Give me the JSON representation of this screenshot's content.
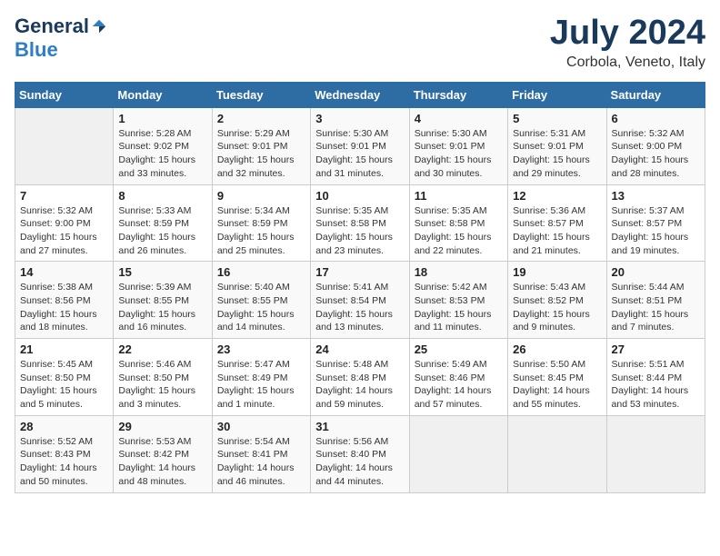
{
  "header": {
    "logo_general": "General",
    "logo_blue": "Blue",
    "month_title": "July 2024",
    "location": "Corbola, Veneto, Italy"
  },
  "days_of_week": [
    "Sunday",
    "Monday",
    "Tuesday",
    "Wednesday",
    "Thursday",
    "Friday",
    "Saturday"
  ],
  "weeks": [
    [
      {
        "day": "",
        "empty": true
      },
      {
        "day": "1",
        "sunrise": "Sunrise: 5:28 AM",
        "sunset": "Sunset: 9:02 PM",
        "daylight": "Daylight: 15 hours and 33 minutes."
      },
      {
        "day": "2",
        "sunrise": "Sunrise: 5:29 AM",
        "sunset": "Sunset: 9:01 PM",
        "daylight": "Daylight: 15 hours and 32 minutes."
      },
      {
        "day": "3",
        "sunrise": "Sunrise: 5:30 AM",
        "sunset": "Sunset: 9:01 PM",
        "daylight": "Daylight: 15 hours and 31 minutes."
      },
      {
        "day": "4",
        "sunrise": "Sunrise: 5:30 AM",
        "sunset": "Sunset: 9:01 PM",
        "daylight": "Daylight: 15 hours and 30 minutes."
      },
      {
        "day": "5",
        "sunrise": "Sunrise: 5:31 AM",
        "sunset": "Sunset: 9:01 PM",
        "daylight": "Daylight: 15 hours and 29 minutes."
      },
      {
        "day": "6",
        "sunrise": "Sunrise: 5:32 AM",
        "sunset": "Sunset: 9:00 PM",
        "daylight": "Daylight: 15 hours and 28 minutes."
      }
    ],
    [
      {
        "day": "7",
        "sunrise": "Sunrise: 5:32 AM",
        "sunset": "Sunset: 9:00 PM",
        "daylight": "Daylight: 15 hours and 27 minutes."
      },
      {
        "day": "8",
        "sunrise": "Sunrise: 5:33 AM",
        "sunset": "Sunset: 8:59 PM",
        "daylight": "Daylight: 15 hours and 26 minutes."
      },
      {
        "day": "9",
        "sunrise": "Sunrise: 5:34 AM",
        "sunset": "Sunset: 8:59 PM",
        "daylight": "Daylight: 15 hours and 25 minutes."
      },
      {
        "day": "10",
        "sunrise": "Sunrise: 5:35 AM",
        "sunset": "Sunset: 8:58 PM",
        "daylight": "Daylight: 15 hours and 23 minutes."
      },
      {
        "day": "11",
        "sunrise": "Sunrise: 5:35 AM",
        "sunset": "Sunset: 8:58 PM",
        "daylight": "Daylight: 15 hours and 22 minutes."
      },
      {
        "day": "12",
        "sunrise": "Sunrise: 5:36 AM",
        "sunset": "Sunset: 8:57 PM",
        "daylight": "Daylight: 15 hours and 21 minutes."
      },
      {
        "day": "13",
        "sunrise": "Sunrise: 5:37 AM",
        "sunset": "Sunset: 8:57 PM",
        "daylight": "Daylight: 15 hours and 19 minutes."
      }
    ],
    [
      {
        "day": "14",
        "sunrise": "Sunrise: 5:38 AM",
        "sunset": "Sunset: 8:56 PM",
        "daylight": "Daylight: 15 hours and 18 minutes."
      },
      {
        "day": "15",
        "sunrise": "Sunrise: 5:39 AM",
        "sunset": "Sunset: 8:55 PM",
        "daylight": "Daylight: 15 hours and 16 minutes."
      },
      {
        "day": "16",
        "sunrise": "Sunrise: 5:40 AM",
        "sunset": "Sunset: 8:55 PM",
        "daylight": "Daylight: 15 hours and 14 minutes."
      },
      {
        "day": "17",
        "sunrise": "Sunrise: 5:41 AM",
        "sunset": "Sunset: 8:54 PM",
        "daylight": "Daylight: 15 hours and 13 minutes."
      },
      {
        "day": "18",
        "sunrise": "Sunrise: 5:42 AM",
        "sunset": "Sunset: 8:53 PM",
        "daylight": "Daylight: 15 hours and 11 minutes."
      },
      {
        "day": "19",
        "sunrise": "Sunrise: 5:43 AM",
        "sunset": "Sunset: 8:52 PM",
        "daylight": "Daylight: 15 hours and 9 minutes."
      },
      {
        "day": "20",
        "sunrise": "Sunrise: 5:44 AM",
        "sunset": "Sunset: 8:51 PM",
        "daylight": "Daylight: 15 hours and 7 minutes."
      }
    ],
    [
      {
        "day": "21",
        "sunrise": "Sunrise: 5:45 AM",
        "sunset": "Sunset: 8:50 PM",
        "daylight": "Daylight: 15 hours and 5 minutes."
      },
      {
        "day": "22",
        "sunrise": "Sunrise: 5:46 AM",
        "sunset": "Sunset: 8:50 PM",
        "daylight": "Daylight: 15 hours and 3 minutes."
      },
      {
        "day": "23",
        "sunrise": "Sunrise: 5:47 AM",
        "sunset": "Sunset: 8:49 PM",
        "daylight": "Daylight: 15 hours and 1 minute."
      },
      {
        "day": "24",
        "sunrise": "Sunrise: 5:48 AM",
        "sunset": "Sunset: 8:48 PM",
        "daylight": "Daylight: 14 hours and 59 minutes."
      },
      {
        "day": "25",
        "sunrise": "Sunrise: 5:49 AM",
        "sunset": "Sunset: 8:46 PM",
        "daylight": "Daylight: 14 hours and 57 minutes."
      },
      {
        "day": "26",
        "sunrise": "Sunrise: 5:50 AM",
        "sunset": "Sunset: 8:45 PM",
        "daylight": "Daylight: 14 hours and 55 minutes."
      },
      {
        "day": "27",
        "sunrise": "Sunrise: 5:51 AM",
        "sunset": "Sunset: 8:44 PM",
        "daylight": "Daylight: 14 hours and 53 minutes."
      }
    ],
    [
      {
        "day": "28",
        "sunrise": "Sunrise: 5:52 AM",
        "sunset": "Sunset: 8:43 PM",
        "daylight": "Daylight: 14 hours and 50 minutes."
      },
      {
        "day": "29",
        "sunrise": "Sunrise: 5:53 AM",
        "sunset": "Sunset: 8:42 PM",
        "daylight": "Daylight: 14 hours and 48 minutes."
      },
      {
        "day": "30",
        "sunrise": "Sunrise: 5:54 AM",
        "sunset": "Sunset: 8:41 PM",
        "daylight": "Daylight: 14 hours and 46 minutes."
      },
      {
        "day": "31",
        "sunrise": "Sunrise: 5:56 AM",
        "sunset": "Sunset: 8:40 PM",
        "daylight": "Daylight: 14 hours and 44 minutes."
      },
      {
        "day": "",
        "empty": true
      },
      {
        "day": "",
        "empty": true
      },
      {
        "day": "",
        "empty": true
      }
    ]
  ]
}
